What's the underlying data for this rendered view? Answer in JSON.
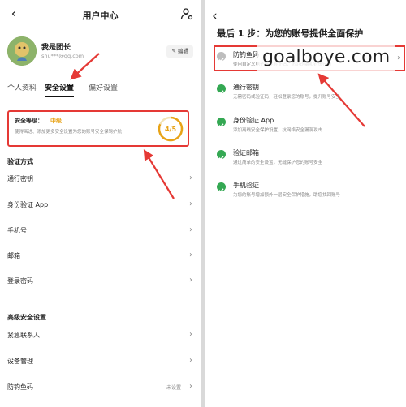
{
  "left": {
    "header": {
      "title": "用户中心"
    },
    "profile": {
      "name": "我是团长",
      "email": "shu***@qq.com",
      "edit_label": "编辑"
    },
    "tabs": [
      {
        "label": "个人资料"
      },
      {
        "label": "安全设置"
      },
      {
        "label": "偏好设置"
      }
    ],
    "security_card": {
      "label": "安全等级：",
      "level": "中级",
      "description": "使得画进、添加更多安全设置为您的账号安全保驾护航",
      "score": "4/5"
    },
    "verification": {
      "heading": "验证方式",
      "items": [
        {
          "label": "通行密钥"
        },
        {
          "label": "身份验证 App"
        },
        {
          "label": "手机号"
        },
        {
          "label": "邮箱"
        },
        {
          "label": "登录密码"
        }
      ]
    },
    "advanced": {
      "heading": "高级安全设置",
      "items": [
        {
          "label": "紧急联系人",
          "value": ""
        },
        {
          "label": "设备管理",
          "value": ""
        },
        {
          "label": "防钓鱼码",
          "value": "未设置"
        }
      ]
    }
  },
  "right": {
    "title": "最后 1 步：为您的账号提供全面保护",
    "items": [
      {
        "name": "防钓鱼码",
        "desc": "使用自定义电子邮件验证码，防范诈骗和钓鱼行为",
        "done": false
      },
      {
        "name": "通行密钥",
        "desc": "无需密码或验证码，轻松登录您的账号，提升账号安全",
        "done": true
      },
      {
        "name": "身份验证 App",
        "desc": "添加离线安全保护设置，抗网络安全漏洞攻击",
        "done": true
      },
      {
        "name": "验证邮箱",
        "desc": "通过简单的安全设置，无缝保护您的账号安全",
        "done": true
      },
      {
        "name": "手机验证",
        "desc": "为您的账号增加额外一层安全保护措施，助您找回账号",
        "done": true
      }
    ],
    "watermark": "goalboye.com"
  },
  "colors": {
    "accent_red": "#e53935",
    "check_green": "#34a853",
    "level_orange": "#e8a317"
  }
}
